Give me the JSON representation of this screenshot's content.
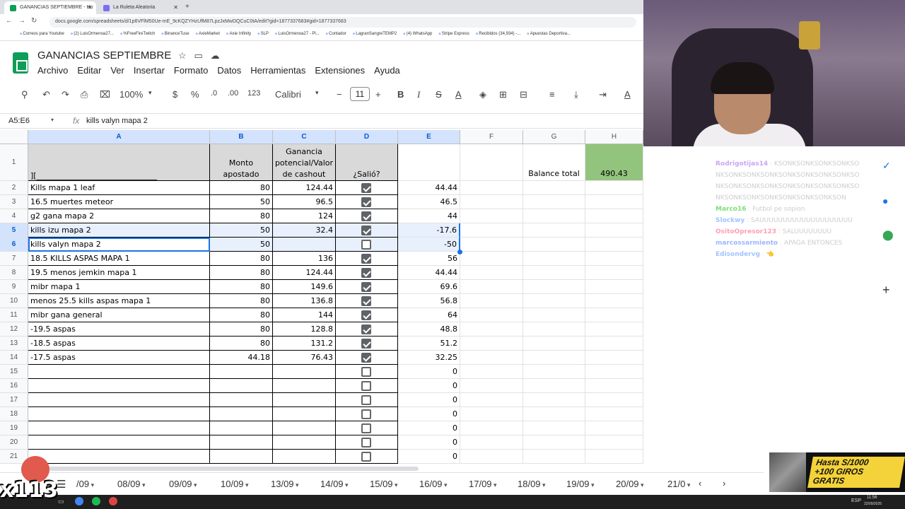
{
  "browser": {
    "tabs": [
      {
        "label": "GANANCIAS SEPTIEMBRE - Ho",
        "active": true,
        "color": "#0f9d58"
      },
      {
        "label": "La Ruleta Aleatoria",
        "active": false,
        "color": "#7b6cf6"
      }
    ],
    "url": "docs.google.com/spreadsheets/d/1p6VFlM50Ue-mE_9cKQZYHzUfM87LpzJxMwDQCuC0tA/edit?gid=1877337683#gid=1877337683",
    "bookmarks": [
      "Correos para Youtube",
      "(2) LuisOrmenoa27...",
      "%FreeFireTwitch",
      "BinanceTuse",
      "AxieMarket",
      "Axie Infinity",
      "SLP",
      "LuisOrmenoa27 - Pl...",
      "Contador",
      "LagranSangreTEMP2",
      "(4) WhatsApp",
      "Stripe Express",
      "Recibidos (34,934) -...",
      "Apuestas Deportiva..."
    ]
  },
  "sheets": {
    "title": "GANANCIAS SEPTIEMBRE",
    "menu": [
      "Archivo",
      "Editar",
      "Ver",
      "Insertar",
      "Formato",
      "Datos",
      "Herramientas",
      "Extensiones",
      "Ayuda"
    ],
    "toolbar": {
      "zoom": "100%",
      "currency": "$",
      "percent": "%",
      "dec_less": ".0",
      "dec_more": ".00",
      "number_format": "123",
      "font": "Calibri",
      "font_size": "11"
    },
    "namebox": "A5:E6",
    "formula": "kills valyn mapa 2"
  },
  "grid": {
    "columns": [
      "A",
      "B",
      "C",
      "D",
      "E",
      "F",
      "G",
      "H"
    ],
    "header_row": {
      "a": "][_______________________________",
      "b": "Monto apostado",
      "c": "Ganancia potencial/Valor de cashout",
      "d": "¿Salió?",
      "g": "Balance total",
      "h": "490.43"
    },
    "rows": [
      {
        "n": "2",
        "a": "Kills mapa 1 leaf",
        "b": "80",
        "c": "124.44",
        "d": true,
        "e": "44.44"
      },
      {
        "n": "3",
        "a": "16.5 muertes meteor",
        "b": "50",
        "c": "96.5",
        "d": true,
        "e": "46.5"
      },
      {
        "n": "4",
        "a": "g2 gana mapa 2",
        "b": "80",
        "c": "124",
        "d": true,
        "e": "44"
      },
      {
        "n": "5",
        "a": "kills izu mapa 2",
        "b": "50",
        "c": "32.4",
        "d": true,
        "e": "-17.6"
      },
      {
        "n": "6",
        "a": "kills valyn mapa 2",
        "b": "50",
        "c": "",
        "d": false,
        "e": "-50"
      },
      {
        "n": "7",
        "a": "18.5 KILLS ASPAS MAPA 1",
        "b": "80",
        "c": "136",
        "d": true,
        "e": "56"
      },
      {
        "n": "8",
        "a": "19.5 menos jemkin mapa 1",
        "b": "80",
        "c": "124.44",
        "d": true,
        "e": "44.44"
      },
      {
        "n": "9",
        "a": "mibr mapa 1",
        "b": "80",
        "c": "149.6",
        "d": true,
        "e": "69.6"
      },
      {
        "n": "10",
        "a": "menos 25.5 kills aspas mapa 1",
        "b": "80",
        "c": "136.8",
        "d": true,
        "e": "56.8"
      },
      {
        "n": "11",
        "a": "mibr gana general",
        "b": "80",
        "c": "144",
        "d": true,
        "e": "64"
      },
      {
        "n": "12",
        "a": "-19.5 aspas",
        "b": "80",
        "c": "128.8",
        "d": true,
        "e": "48.8"
      },
      {
        "n": "13",
        "a": "-18.5 aspas",
        "b": "80",
        "c": "131.2",
        "d": true,
        "e": "51.2"
      },
      {
        "n": "14",
        "a": "-17.5 aspas",
        "b": "44.18",
        "c": "76.43",
        "d": true,
        "e": "32.25"
      },
      {
        "n": "15",
        "a": "",
        "b": "",
        "c": "",
        "d": false,
        "e": "0"
      },
      {
        "n": "16",
        "a": "",
        "b": "",
        "c": "",
        "d": false,
        "e": "0"
      },
      {
        "n": "17",
        "a": "",
        "b": "",
        "c": "",
        "d": false,
        "e": "0"
      },
      {
        "n": "18",
        "a": "",
        "b": "",
        "c": "",
        "d": false,
        "e": "0"
      },
      {
        "n": "19",
        "a": "",
        "b": "",
        "c": "",
        "d": false,
        "e": "0"
      },
      {
        "n": "20",
        "a": "",
        "b": "",
        "c": "",
        "d": false,
        "e": "0"
      },
      {
        "n": "21",
        "a": "",
        "b": "",
        "c": "",
        "d": false,
        "e": "0"
      }
    ]
  },
  "sheet_tabs": [
    "/09",
    "08/09",
    "09/09",
    "10/09",
    "13/09",
    "14/09",
    "15/09",
    "16/09",
    "17/09",
    "18/09",
    "19/09",
    "20/09",
    "21/0"
  ],
  "chat": [
    {
      "user": "Rodrigotijas14",
      "msg": "KSONKSONKSONKSONKSONKSONKSONKSONKSONKSONKSONKSONKSONKSONKSONKSONKSONKSONKSONKSONKSONKSONKSONKSONKSONKSONKSONKSON",
      "color": "#c9a7f5"
    },
    {
      "user": "Marco16",
      "msg": "Futbol pe sopion",
      "color": "#7be07b"
    },
    {
      "user": "Slockwy",
      "msg": "SAUUUUUUUUUUUUUUUUUUUU",
      "color": "#a0c4ff"
    },
    {
      "user": "OsitoOpresor123",
      "msg": "SALUUUUUUUU",
      "color": "#ff9fb3"
    },
    {
      "user": "marcossarmiento",
      "msg": "APAGA ENTONCES",
      "color": "#9bb7ff"
    },
    {
      "user": "Edisondervg",
      "msg": "👈",
      "color": "#9fc5ff"
    }
  ],
  "promo": {
    "line1": "Hasta S/1000",
    "line2": "+100 GIROS",
    "line3": "GRATIS"
  },
  "overlay": {
    "counter": "x113"
  },
  "taskbar": {
    "time": "11:56",
    "date": "22/09/2025",
    "lang": "ESP"
  }
}
